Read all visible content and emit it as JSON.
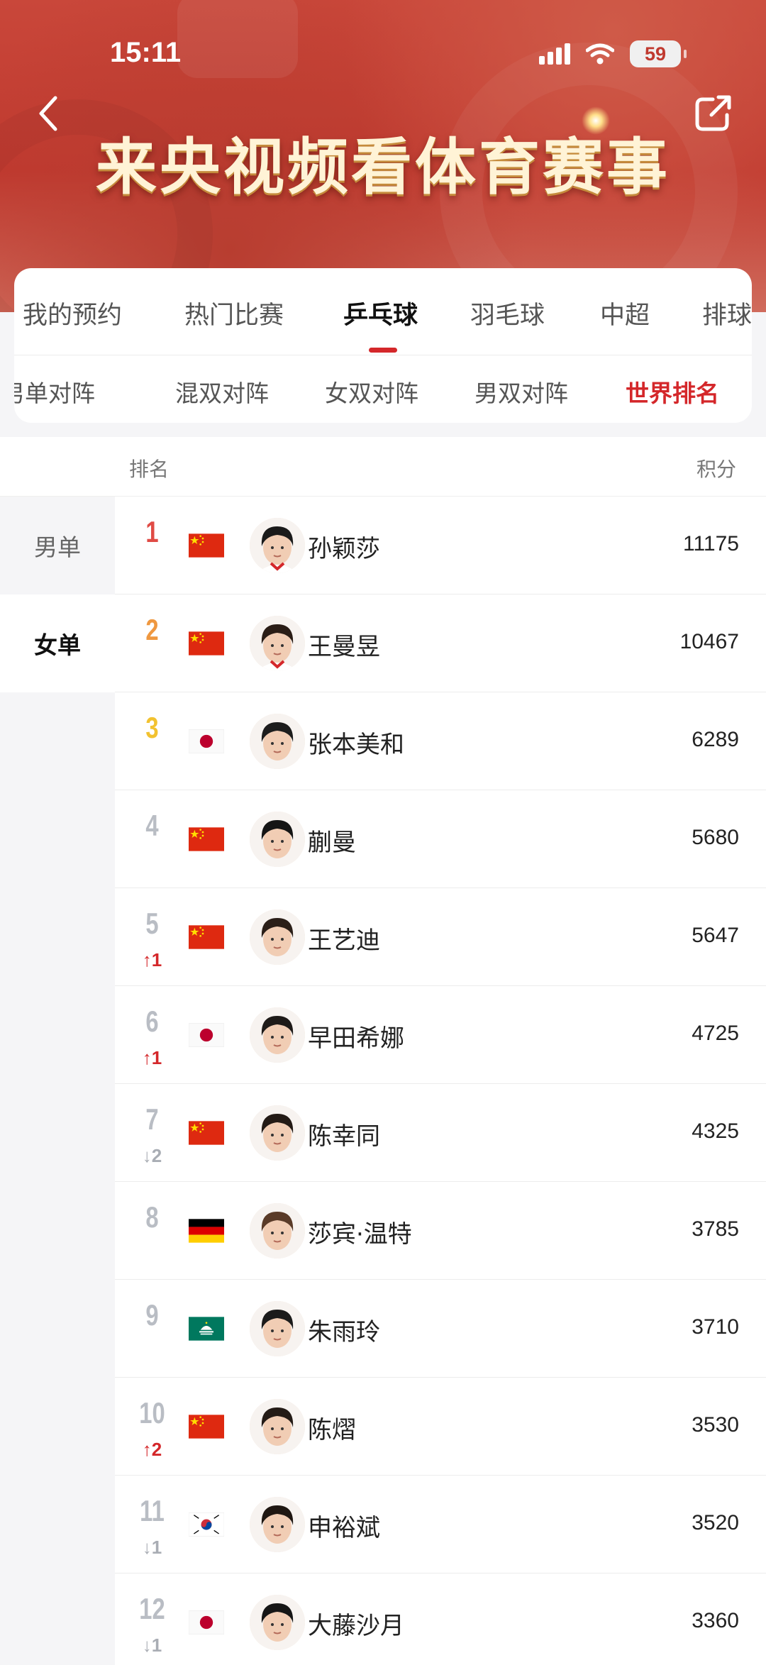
{
  "status_bar": {
    "time": "15:11",
    "battery": "59"
  },
  "header": {
    "title": "来央视频看体育赛事"
  },
  "colors": {
    "accent": "#d4272a",
    "hero": "#c0392f"
  },
  "icons": {
    "back": "chevron-left-icon",
    "share": "share-icon"
  },
  "tabs": [
    {
      "label": "我的预约"
    },
    {
      "label": "热门比赛"
    },
    {
      "label": "乒乓球"
    },
    {
      "label": "羽毛球"
    },
    {
      "label": "中超"
    },
    {
      "label": "排球"
    }
  ],
  "active_tab": "乒乓球",
  "subtabs": [
    {
      "label": "男单对阵"
    },
    {
      "label": "混双对阵"
    },
    {
      "label": "女双对阵"
    },
    {
      "label": "男双对阵"
    },
    {
      "label": "世界排名"
    }
  ],
  "active_subtab": "世界排名",
  "list_header": {
    "rank": "排名",
    "points": "积分"
  },
  "categories": [
    {
      "label": "男单"
    },
    {
      "label": "女单"
    }
  ],
  "active_category": "女单",
  "rankings": [
    {
      "rank": "1",
      "change": "",
      "flag": "China",
      "name": "孙颖莎",
      "points": "11175"
    },
    {
      "rank": "2",
      "change": "",
      "flag": "China",
      "name": "王曼昱",
      "points": "10467"
    },
    {
      "rank": "3",
      "change": "",
      "flag": "Japan",
      "name": "张本美和",
      "points": "6289"
    },
    {
      "rank": "4",
      "change": "",
      "flag": "China",
      "name": "蒯曼",
      "points": "5680"
    },
    {
      "rank": "5",
      "change": "↑1",
      "flag": "China",
      "name": "王艺迪",
      "points": "5647"
    },
    {
      "rank": "6",
      "change": "↑1",
      "flag": "Japan",
      "name": "早田希娜",
      "points": "4725"
    },
    {
      "rank": "7",
      "change": "↓2",
      "flag": "China",
      "name": "陈幸同",
      "points": "4325"
    },
    {
      "rank": "8",
      "change": "",
      "flag": "Germany",
      "name": "莎宾·温特",
      "points": "3785"
    },
    {
      "rank": "9",
      "change": "",
      "flag": "Macau",
      "name": "朱雨玲",
      "points": "3710"
    },
    {
      "rank": "10",
      "change": "↑2",
      "flag": "China",
      "name": "陈熠",
      "points": "3530"
    },
    {
      "rank": "11",
      "change": "↓1",
      "flag": "South Korea",
      "name": "申裕斌",
      "points": "3520"
    },
    {
      "rank": "12",
      "change": "↓1",
      "flag": "Japan",
      "name": "大藤沙月",
      "points": "3360"
    }
  ]
}
